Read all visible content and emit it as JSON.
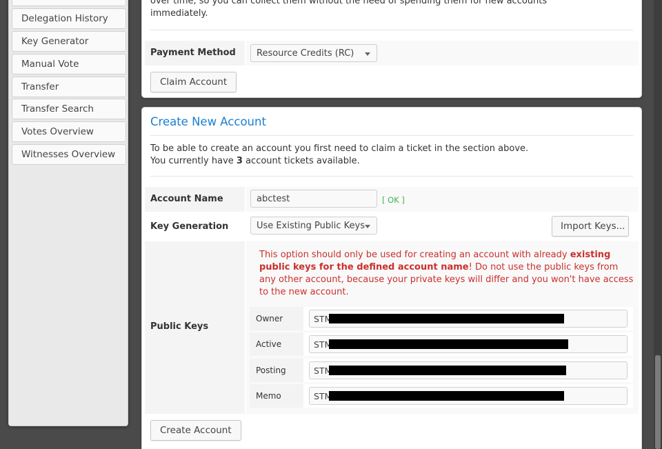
{
  "sidebar": {
    "items": [
      {
        "label": "Delegation History"
      },
      {
        "label": "Key Generator"
      },
      {
        "label": "Manual Vote"
      },
      {
        "label": "Transfer"
      },
      {
        "label": "Transfer Search"
      },
      {
        "label": "Votes Overview"
      },
      {
        "label": "Witnesses Overview"
      }
    ]
  },
  "claim": {
    "intro_line1": "over time, so you can collect them without the need of spending them for new accounts",
    "intro_line2": "immediately.",
    "payment_label": "Payment Method",
    "payment_value": "Resource Credits (RC)",
    "claim_button": "Claim Account"
  },
  "create": {
    "title": "Create New Account",
    "desc_line1": "To be able to create an account you first need to claim a ticket in the section above.",
    "desc_prefix": "You currently have ",
    "ticket_count": "3",
    "desc_suffix": " account tickets available.",
    "account_name_label": "Account Name",
    "account_name_value": "abctest",
    "account_status": "[ OK ]",
    "key_gen_label": "Key Generation",
    "key_gen_value": "Use Existing Public Keys",
    "import_button": "Import Keys...",
    "public_keys_label": "Public Keys",
    "warning_part1": "This option should only be used for creating an account with already ",
    "warning_bold": "existing public keys for the defined account name",
    "warning_part2": "! Do not use the public keys from any other account, because your private keys will differ and you won't have access to the new account.",
    "keys": [
      {
        "role": "Owner",
        "value": "STM"
      },
      {
        "role": "Active",
        "value": "STM"
      },
      {
        "role": "Posting",
        "value": "STM"
      },
      {
        "role": "Memo",
        "value": "STM"
      }
    ],
    "create_button": "Create Account"
  }
}
